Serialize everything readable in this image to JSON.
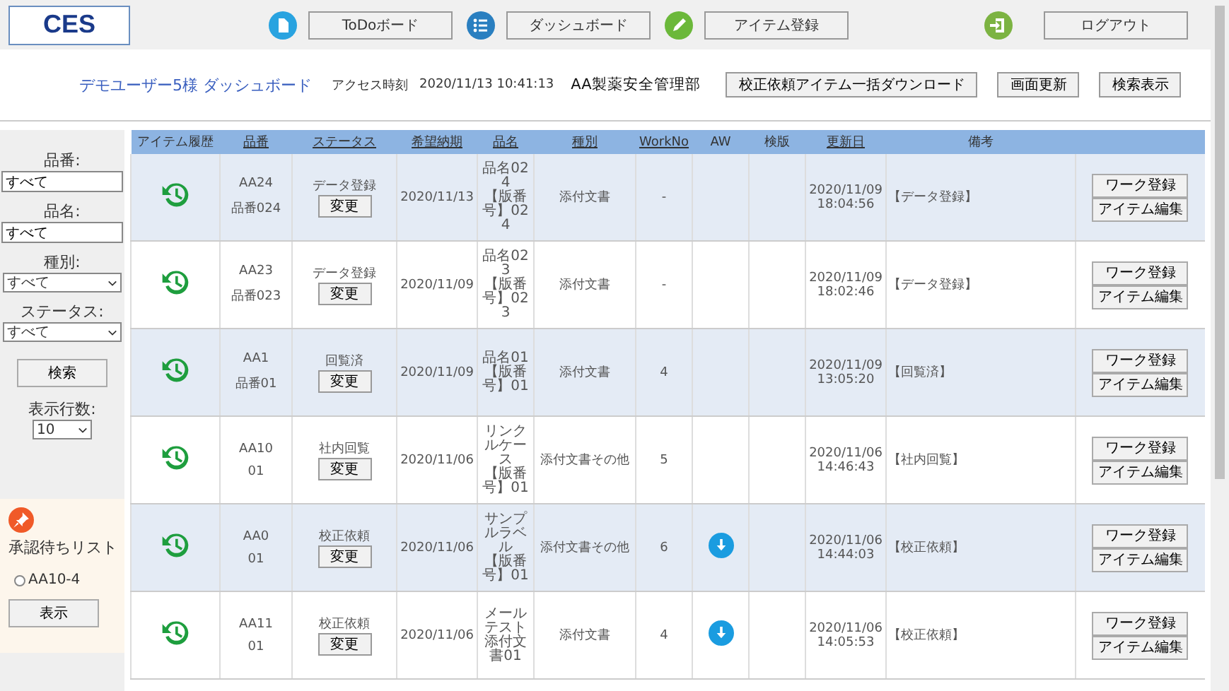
{
  "header": {
    "logo": "CES",
    "nav": [
      {
        "label": "ToDoボード"
      },
      {
        "label": "ダッシュボード"
      },
      {
        "label": "アイテム登録"
      }
    ],
    "logout": "ログアウト"
  },
  "subheader": {
    "title": "デモユーザー5様 ダッシュボード",
    "access_label": "アクセス時刻",
    "access_time": "2020/11/13 10:41:13",
    "department": "AA製薬安全管理部",
    "buttons": [
      "校正依頼アイテム一括ダウンロード",
      "画面更新",
      "検索表示"
    ]
  },
  "sidebar": {
    "filters": [
      {
        "label": "品番:",
        "kind": "input",
        "value": "すべて"
      },
      {
        "label": "品名:",
        "kind": "input",
        "value": "すべて"
      },
      {
        "label": "種別:",
        "kind": "select",
        "value": "すべて"
      },
      {
        "label": "ステータス:",
        "kind": "select",
        "value": "すべて"
      }
    ],
    "search_button": "検索",
    "rows_label": "表示行数:",
    "rows_value": "10",
    "pending": {
      "title": "承認待ちリスト",
      "items": [
        {
          "label": "AA10-4",
          "selected": false
        }
      ],
      "button": "表示"
    }
  },
  "table": {
    "columns": [
      {
        "label": "アイテム履歴",
        "sortable": false
      },
      {
        "label": "品番",
        "sortable": true
      },
      {
        "label": "ステータス",
        "sortable": true
      },
      {
        "label": "希望納期",
        "sortable": true
      },
      {
        "label": "品名",
        "sortable": true
      },
      {
        "label": "種別",
        "sortable": true
      },
      {
        "label": "WorkNo",
        "sortable": true
      },
      {
        "label": "AW",
        "sortable": false
      },
      {
        "label": "検版",
        "sortable": false
      },
      {
        "label": "更新日",
        "sortable": true
      },
      {
        "label": "備考",
        "sortable": false
      }
    ],
    "rows": [
      {
        "code": "AA24",
        "number": "品番024",
        "status": "データ登録",
        "change": "変更",
        "actions": [
          "ワーク登録",
          "アイテム編集"
        ],
        "due": "2020/11/13",
        "name": "品名024",
        "version": "【版番号】024",
        "type": "添付文書",
        "work_no": "-",
        "aw": false,
        "updated_date": "2020/11/09",
        "updated_time": "18:04:56",
        "remarks": "【データ登録】"
      },
      {
        "code": "AA23",
        "number": "品番023",
        "status": "データ登録",
        "change": "変更",
        "actions": [
          "ワーク登録",
          "アイテム編集"
        ],
        "due": "2020/11/09",
        "name": "品名023",
        "version": "【版番号】023",
        "type": "添付文書",
        "work_no": "-",
        "aw": false,
        "updated_date": "2020/11/09",
        "updated_time": "18:02:46",
        "remarks": "【データ登録】"
      },
      {
        "code": "AA1",
        "number": "品番01",
        "status": "回覧済",
        "change": "変更",
        "actions": [
          "ワーク登録",
          "アイテム編集"
        ],
        "due": "2020/11/09",
        "name": "品名01",
        "version": "【版番号】01",
        "type": "添付文書",
        "work_no": "4",
        "aw": false,
        "updated_date": "2020/11/09",
        "updated_time": "13:05:20",
        "remarks": "【回覧済】"
      },
      {
        "code": "AA10",
        "number": "01",
        "status": "社内回覧",
        "change": "変更",
        "actions": [
          "ワーク登録",
          "アイテム編集"
        ],
        "due": "2020/11/06",
        "name": "リンクルケース",
        "version": "【版番号】01",
        "type": "添付文書その他",
        "work_no": "5",
        "aw": false,
        "updated_date": "2020/11/06",
        "updated_time": "14:46:43",
        "remarks": "【社内回覧】"
      },
      {
        "code": "AA0",
        "number": "01",
        "status": "校正依頼",
        "change": "変更",
        "actions": [
          "ワーク登録",
          "アイテム編集"
        ],
        "due": "2020/11/06",
        "name": "サンプルラベル",
        "version": "【版番号】01",
        "type": "添付文書その他",
        "work_no": "6",
        "aw": true,
        "updated_date": "2020/11/06",
        "updated_time": "14:44:03",
        "remarks": "【校正依頼】"
      },
      {
        "code": "AA11",
        "number": "01",
        "status": "校正依頼",
        "change": "変更",
        "actions": [
          "ワーク登録",
          "アイテム編集"
        ],
        "due": "2020/11/06",
        "name": "メールテスト添付文書01",
        "type": "添付文書",
        "work_no": "4",
        "aw": true,
        "updated_date": "2020/11/06",
        "updated_time": "14:05:53",
        "remarks": "【校正依頼】"
      }
    ]
  }
}
